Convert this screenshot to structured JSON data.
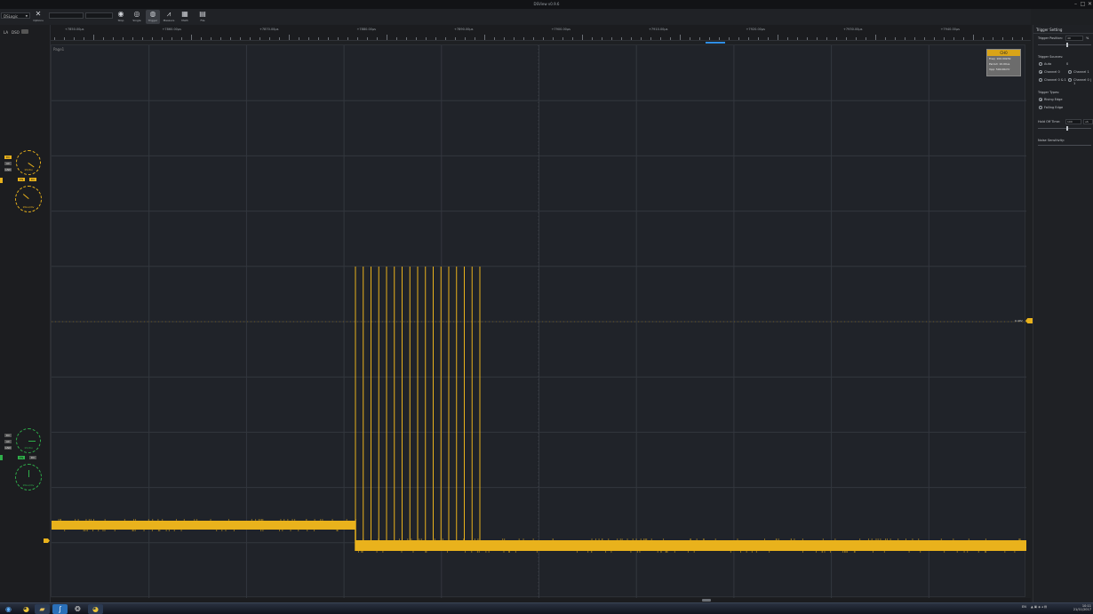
{
  "window": {
    "title": "DSView v0.9.6"
  },
  "toolbar": {
    "device_dropdown": "DSLogic",
    "buttons": [
      {
        "label": "Options",
        "icon": "wrench-screwdriver-icon"
      },
      {
        "label": "Stop",
        "icon": "eye-stop-icon"
      },
      {
        "label": "Single",
        "icon": "eye-single-icon"
      },
      {
        "label": "Trigger",
        "icon": "trigger-icon"
      },
      {
        "label": "Measure",
        "icon": "measure-icon"
      },
      {
        "label": "Math",
        "icon": "math-icon"
      },
      {
        "label": "File",
        "icon": "printer-file-icon"
      }
    ]
  },
  "left_panel": {
    "mode_labels": [
      "LA",
      "DSO"
    ],
    "ch0": {
      "color": "#e9b21c",
      "coupling": [
        "DC",
        "AC",
        "GND"
      ],
      "enable_labels": [
        "EN",
        "DC"
      ],
      "vdiv_label": "1V/div",
      "hpos_label": "20us/div"
    },
    "ch1": {
      "color": "#2fae4a",
      "coupling": [
        "DC",
        "AC",
        "GND"
      ],
      "enable_labels": [
        "EN",
        "DC"
      ],
      "vdiv_label": "1V/div",
      "hpos_label": "20us/div"
    }
  },
  "ruler": {
    "labels": [
      "+7850.00µs",
      "+7860.00µs",
      "+7870.00µs",
      "+7880.00µs",
      "+7890.00µs",
      "+7900.00µs",
      "+7910.00µs",
      "+7920.00µs",
      "+7930.00µs",
      "+7940.00µs"
    ]
  },
  "plot": {
    "corner_label": "Page1",
    "trigger_level_label": "0.40V",
    "channel_color": "#e9b21c"
  },
  "measure_box": {
    "header": "CH0",
    "rows": [
      "Freq: 100.00kHz",
      "Period: 10.00us",
      "Vpp: 500.00mV"
    ]
  },
  "right_panel": {
    "title": "Trigger Setting",
    "trigger_position_label": "Trigger Position:",
    "trigger_position_value": "40",
    "trigger_position_unit": "%",
    "trigger_sources_label": "Trigger Sources:",
    "sources": [
      {
        "label": "Auto",
        "selected": false
      },
      {
        "label": "Channel 0",
        "selected": true
      },
      {
        "label": "Channel 1",
        "selected": false
      },
      {
        "label": "Channel 0 & 1",
        "selected": false
      },
      {
        "label": "Channel 0 | 1",
        "selected": false
      }
    ],
    "auto_value": "0",
    "trigger_types_label": "Trigger Types:",
    "types": [
      {
        "label": "Rising Edge",
        "selected": true
      },
      {
        "label": "Falling Edge",
        "selected": false
      }
    ],
    "holdoff_label": "Hold Off Time:",
    "holdoff_value": "100",
    "holdoff_unit": "uS",
    "noise_label": "Noise Sensitivity:"
  },
  "taskbar": {
    "apps": [
      "start-orb-icon",
      "chrome-icon",
      "explorer-icon",
      "dsview-icon",
      "network-icon",
      "chrome-icon"
    ],
    "tray_lang": "EN",
    "clock_time": "10:11",
    "clock_date": "21/11/2017"
  }
}
